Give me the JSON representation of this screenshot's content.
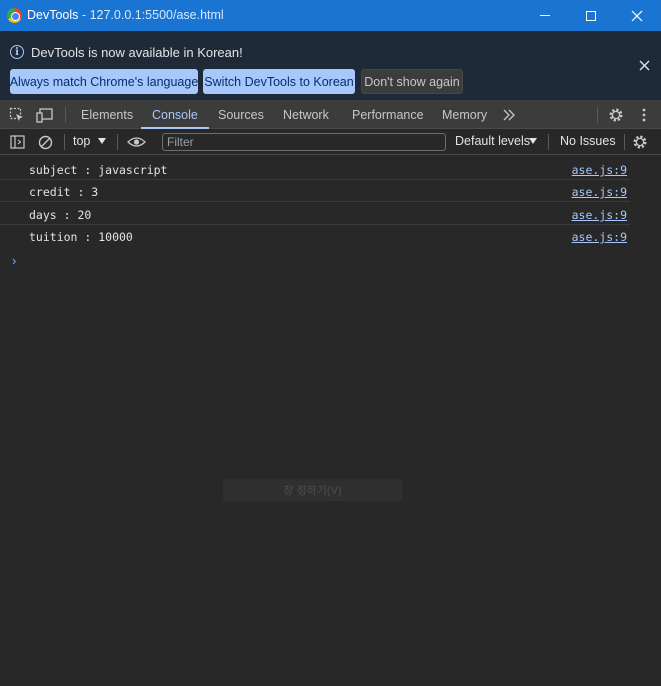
{
  "window": {
    "app_name": "DevTools",
    "separator": "-",
    "url": "127.0.0.1:5500/ase.html"
  },
  "infobar": {
    "message": "DevTools is now available in Korean!",
    "buttons": [
      {
        "label": "Always match Chrome's language"
      },
      {
        "label": "Switch DevTools to Korean"
      },
      {
        "label": "Don't show again"
      }
    ],
    "close_glyph": "✕"
  },
  "tabs": [
    {
      "label": "Elements"
    },
    {
      "label": "Console"
    },
    {
      "label": "Sources"
    },
    {
      "label": "Network"
    },
    {
      "label": "Performance"
    },
    {
      "label": "Memory"
    }
  ],
  "active_tab": "Console",
  "console_toolbar": {
    "context": "top",
    "filter_placeholder": "Filter",
    "levels": "Default levels",
    "issues": "No Issues"
  },
  "messages": [
    {
      "text": "subject : javascript",
      "source": "ase.js:9"
    },
    {
      "text": "credit : 3",
      "source": "ase.js:9"
    },
    {
      "text": "days : 20",
      "source": "ase.js:9"
    },
    {
      "text": "tuition : 10000",
      "source": "ase.js:9"
    }
  ],
  "prompt_glyph": "›",
  "ghost_text": "창 정하기(V)",
  "colors": {
    "titlebar": "#1a74d2",
    "accent": "#a8c7fa",
    "background": "#282828",
    "link": "#a8c7fa"
  }
}
